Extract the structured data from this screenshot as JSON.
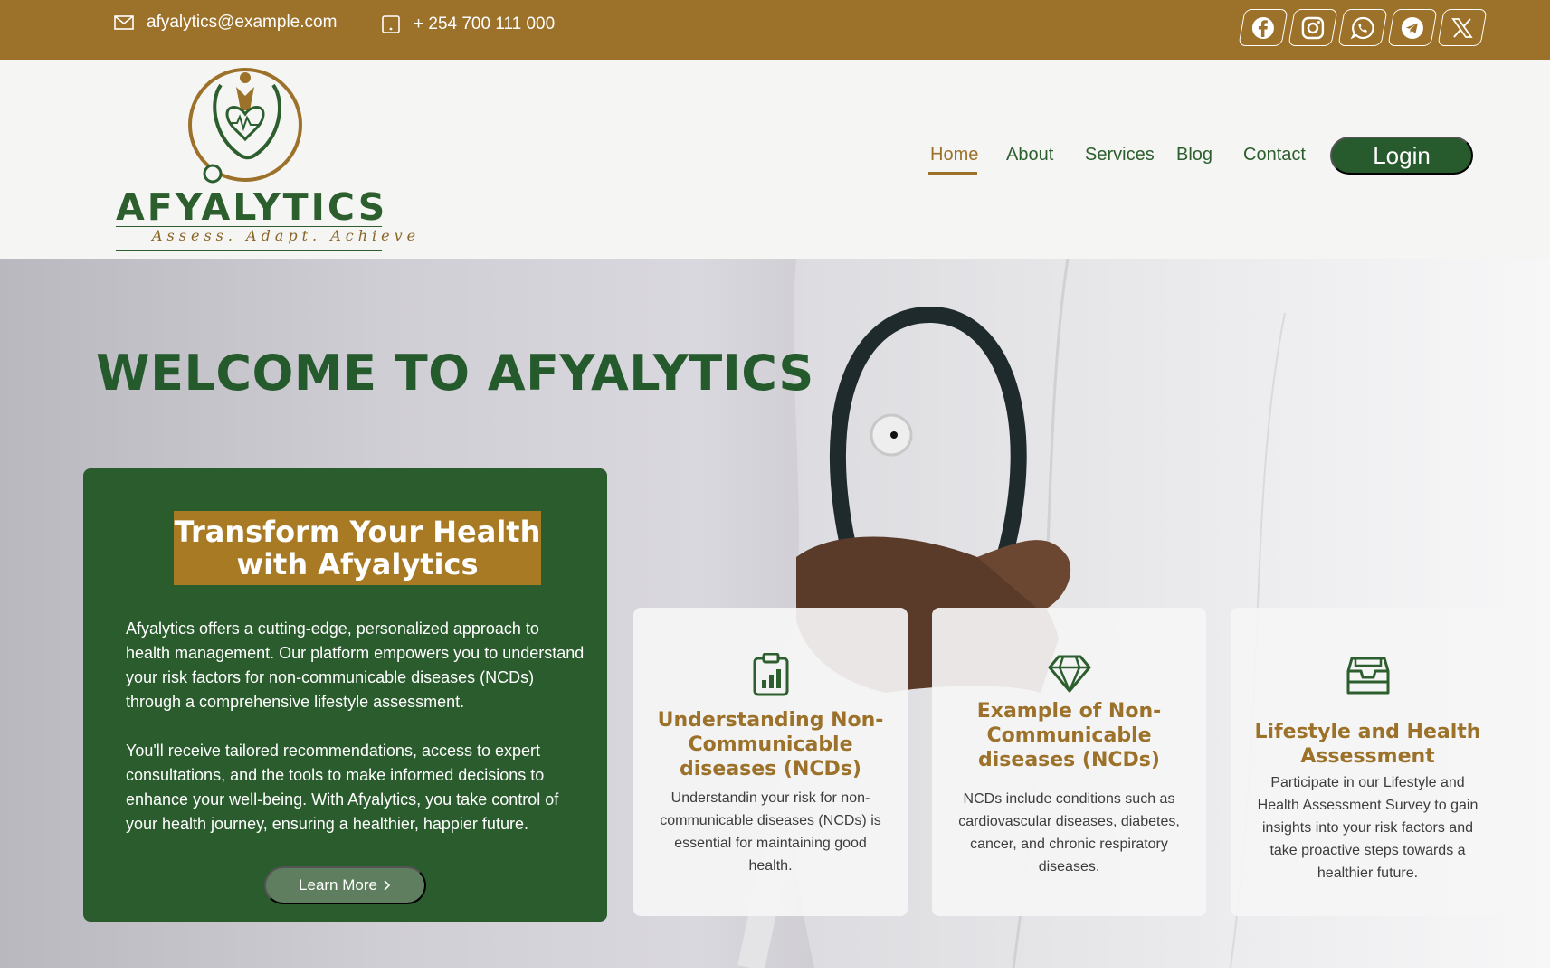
{
  "topbar": {
    "email": "afyalytics@example.com",
    "phone": "+ 254 700 111 000",
    "socials": [
      "facebook-icon",
      "instagram-icon",
      "whatsapp-icon",
      "telegram-icon",
      "x-icon"
    ]
  },
  "logo": {
    "name": "AFYALYTICS",
    "tagline": "Assess. Adapt. Achieve"
  },
  "nav": {
    "items": [
      "Home",
      "About",
      "Services",
      "Blog",
      "Contact"
    ],
    "active": "Home",
    "login": "Login"
  },
  "hero": {
    "title": "WELCOME TO AFYALYTICS",
    "card": {
      "heading_line1": "Transform Your Health",
      "heading_line2": "with Afyalytics",
      "paragraph1": "Afyalytics offers a cutting-edge, personalized approach to health management. Our platform empowers you to understand your risk factors for non-communicable diseases (NCDs) through a comprehensive lifestyle assessment.",
      "paragraph2": "You'll receive tailored recommendations, access to expert consultations, and the tools to make informed decisions to enhance your well-being. With Afyalytics, you take control of your health journey, ensuring a healthier, happier future.",
      "button": "Learn More"
    },
    "info_cards": [
      {
        "icon": "clipboard-chart-icon",
        "title": "Understanding Non-Communicable diseases (NCDs)",
        "text": "Understandin your risk for non-communicable diseases (NCDs) is essential for maintaining good health."
      },
      {
        "icon": "diamond-icon",
        "title": "Example of Non-Communicable diseases (NCDs)",
        "text": "NCDs include conditions such as cardiovascular diseases, diabetes, cancer, and chronic respiratory diseases."
      },
      {
        "icon": "inbox-icon",
        "title": "Lifestyle and Health Assessment",
        "text": "Participate in our Lifestyle and Health Assessment Survey to gain insights into your risk factors and take proactive steps towards a healthier future."
      }
    ]
  },
  "colors": {
    "brand_gold": "#9c7129",
    "brand_green": "#2a5c2d",
    "header_bg": "#f5f5f4"
  }
}
